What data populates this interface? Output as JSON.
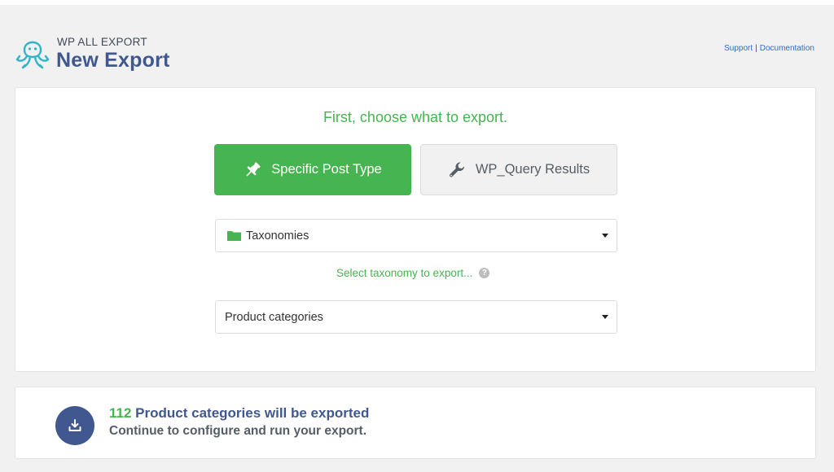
{
  "header": {
    "brand_small": "WP ALL EXPORT",
    "title": "New Export",
    "links": {
      "support": "Support",
      "separator": "|",
      "documentation": "Documentation"
    }
  },
  "main": {
    "heading": "First, choose what to export.",
    "buttons": {
      "specific_post_type": "Specific Post Type",
      "wp_query_results": "WP_Query Results"
    },
    "post_type_select": {
      "selected": "Taxonomies",
      "icon": "folder-icon"
    },
    "taxonomy_hint": "Select taxonomy to export...",
    "help_glyph": "?",
    "taxonomy_select": {
      "selected": "Product categories"
    }
  },
  "summary": {
    "count": "112",
    "label": "Product categories will be exported",
    "subtext": "Continue to configure and run your export."
  },
  "colors": {
    "green": "#46b450",
    "brand_blue": "#40588f",
    "link_blue": "#2d6ad4",
    "background": "#f1f1f1"
  }
}
